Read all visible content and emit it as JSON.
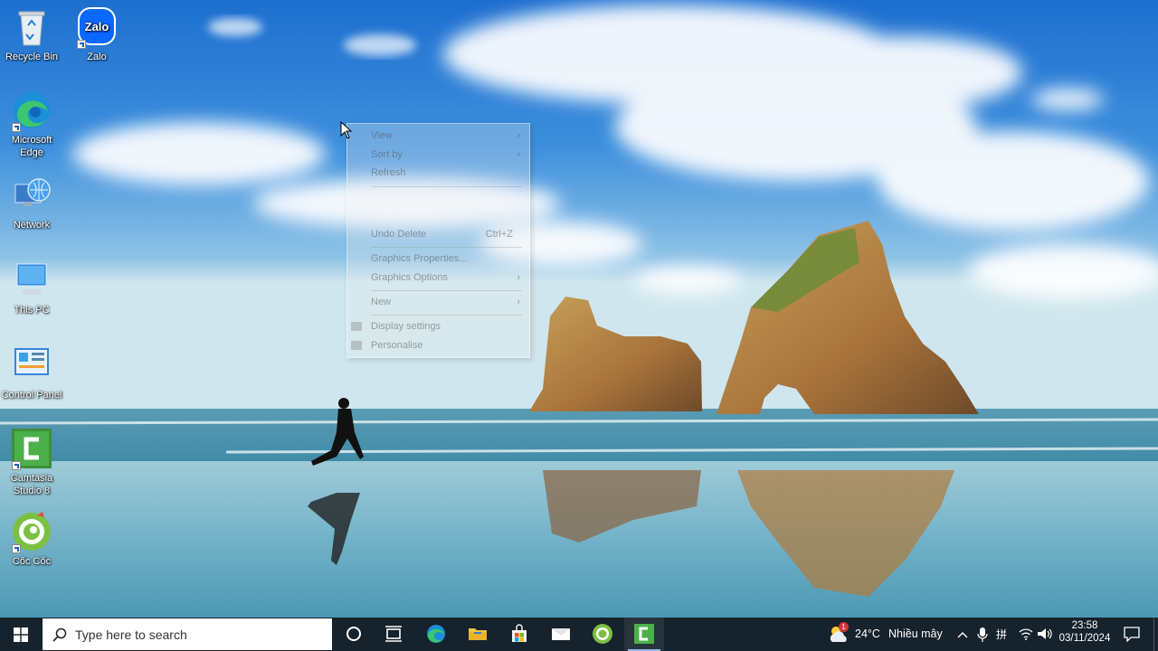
{
  "desktop": {
    "icons": [
      {
        "name": "recycle-bin",
        "label": "Recycle Bin"
      },
      {
        "name": "zalo",
        "label": "Zalo",
        "logo_text": "Zalo"
      },
      {
        "name": "microsoft-edge",
        "label": "Microsoft Edge"
      },
      {
        "name": "network",
        "label": "Network"
      },
      {
        "name": "this-pc",
        "label": "This PC"
      },
      {
        "name": "control-panel",
        "label": "Control Panel"
      },
      {
        "name": "camtasia-studio",
        "label": "Camtasia Studio 8"
      },
      {
        "name": "coc-coc",
        "label": "Cốc Cốc"
      }
    ]
  },
  "context_menu": {
    "items": {
      "view": "View",
      "sort_by": "Sort by",
      "refresh": "Refresh",
      "undo_delete": "Undo Delete",
      "undo_shortcut": "Ctrl+Z",
      "graphics_properties": "Graphics Properties...",
      "graphics_options": "Graphics Options",
      "new": "New",
      "display_settings": "Display settings",
      "personalise": "Personalise"
    },
    "submenu_arrow": "›"
  },
  "taskbar": {
    "search_placeholder": "Type here to search",
    "weather": {
      "temperature": "24°C",
      "condition": "Nhiều mây",
      "badge": "1"
    },
    "clock": {
      "time": "23:58",
      "date": "03/11/2024"
    },
    "language_indicator": "拼",
    "accent_color": "#8fb8e8",
    "background_color": "#16222c"
  }
}
